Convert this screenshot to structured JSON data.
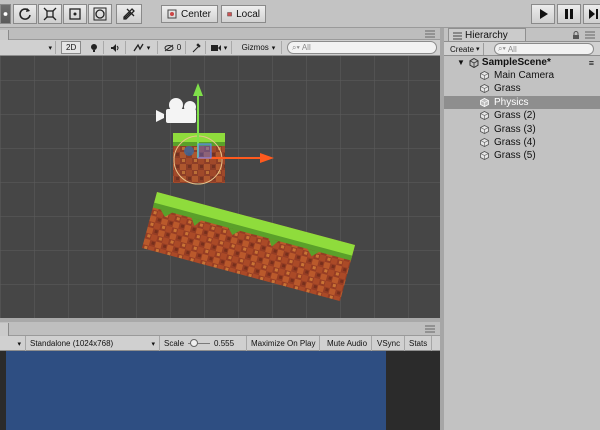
{
  "toolbar": {
    "tools": [
      "hand-tool",
      "move-tool",
      "rotate-tool",
      "scale-tool",
      "rect-tool",
      "transform-tool"
    ],
    "pivot_label": "Center",
    "space_label": "Local"
  },
  "scene_toolbar": {
    "mode_2d": "2D",
    "hidden_count": "0",
    "gizmos_label": "Gizmos",
    "search_placeholder": "All"
  },
  "game_toolbar": {
    "display_value": "Standalone (1024x768)",
    "scale_label": "Scale",
    "scale_value": "0.555",
    "scale_fraction": 0.12,
    "maximize_label": "Maximize On Play",
    "mute_label": "Mute Audio",
    "vsync_label": "VSync",
    "stats_label": "Stats"
  },
  "hierarchy": {
    "tab_label": "Hierarchy",
    "create_label": "Create",
    "search_placeholder": "All",
    "scene_name": "SampleScene*",
    "items": [
      {
        "label": "Main Camera",
        "selected": false
      },
      {
        "label": "Grass",
        "selected": false
      },
      {
        "label": "Physics",
        "selected": true
      },
      {
        "label": "Grass (2)",
        "selected": false
      },
      {
        "label": "Grass (3)",
        "selected": false
      },
      {
        "label": "Grass (4)",
        "selected": false
      },
      {
        "label": "Grass (5)",
        "selected": false
      }
    ]
  },
  "colors": {
    "scene_background": "#464646",
    "game_background": "#2e4e82",
    "selection": "#8e8e8e",
    "gizmo_x": "#ff5a1e",
    "gizmo_y": "#7fe04a",
    "grass": "#8fdc3c",
    "dirt": "#c0572c"
  }
}
